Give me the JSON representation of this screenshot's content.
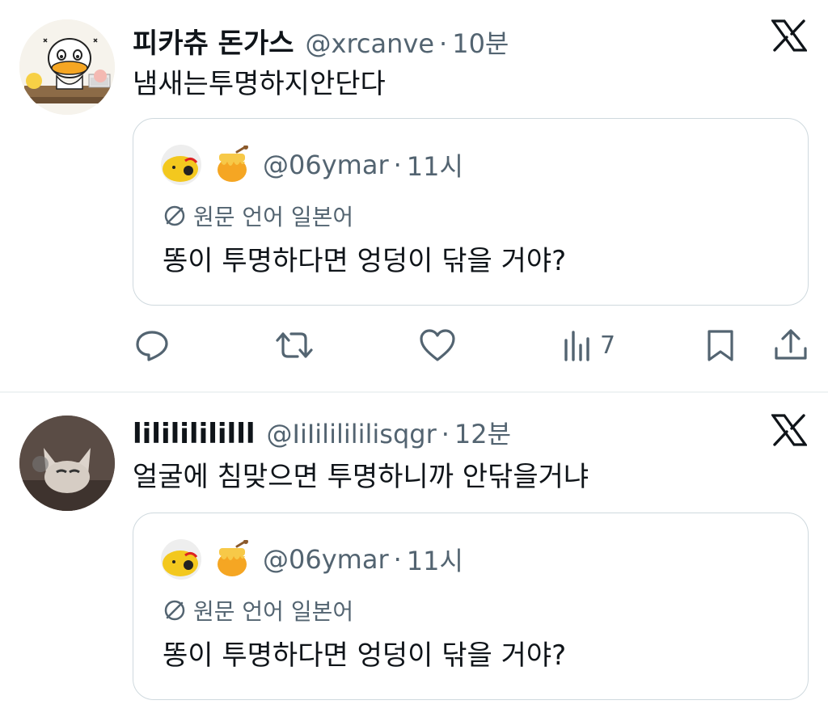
{
  "posts": [
    {
      "name": "피카츄 돈가스",
      "handle": "@xrcanve",
      "separator": "·",
      "time": "10분",
      "text": "냄새는투명하지안단다",
      "avatar_icon": "cartoon-duck-avatar",
      "quote": {
        "emoji_icon": "honey-pot-icon",
        "handle": "@06ymar",
        "separator": "·",
        "time": "11시",
        "lang_note": "원문 언어 일본어",
        "text": "똥이 투명하다면 엉덩이 닦을 거야?"
      },
      "actions": {
        "views": "7"
      }
    },
    {
      "name": "lilililililll",
      "handle": "@IiIililililisqgr",
      "separator": "·",
      "time": "12분",
      "text": "얼굴에 침맞으면 투명하니까 안닦을거냐",
      "avatar_icon": "cat-figure-avatar",
      "quote": {
        "emoji_icon": "honey-pot-icon",
        "handle": "@06ymar",
        "separator": "·",
        "time": "11시",
        "lang_note": "원문 언어 일본어",
        "text": "똥이 투명하다면 엉덩이 닦을 거야?"
      }
    }
  ],
  "colors": {
    "text": "#0f1419",
    "secondary": "#536471",
    "border": "#cfd9de",
    "divider": "#eff3f4"
  }
}
